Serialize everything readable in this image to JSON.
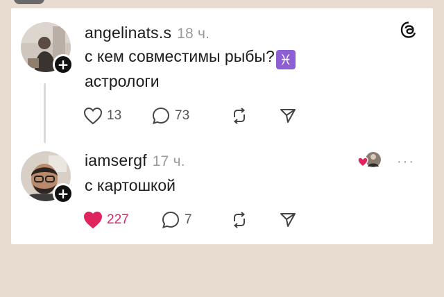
{
  "posts": [
    {
      "username": "angelinats.s",
      "time": "18 ч.",
      "text_line1": "с кем совместимы рыбы?",
      "zodiac": "♓",
      "text_line2": "астрологи",
      "likes": "13",
      "replies": "73",
      "liked": false
    },
    {
      "username": "iamsergf",
      "time": "17 ч.",
      "text_line1": "с картошкой",
      "likes": "227",
      "replies": "7",
      "liked": true
    }
  ],
  "icons": {
    "plus": "+",
    "more": "···"
  },
  "colors": {
    "background": "#e8dcd1",
    "heart_liked": "#e0245e",
    "zodiac_bg": "#8d5fd3"
  }
}
